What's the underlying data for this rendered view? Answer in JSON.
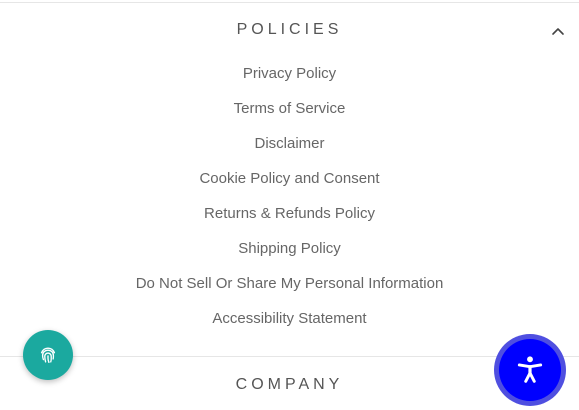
{
  "policies": {
    "title": "POLICIES",
    "links": [
      {
        "label": "Privacy Policy"
      },
      {
        "label": "Terms of Service"
      },
      {
        "label": "Disclaimer"
      },
      {
        "label": "Cookie Policy and Consent"
      },
      {
        "label": "Returns & Refunds Policy"
      },
      {
        "label": "Shipping Policy"
      },
      {
        "label": "Do Not Sell Or Share My Personal Information"
      },
      {
        "label": "Accessibility Statement"
      }
    ]
  },
  "company": {
    "title": "COMPANY"
  },
  "icons": {
    "policies_toggle": "chevron-up-icon",
    "privacy_widget": "fingerprint-icon",
    "accessibility_widget": "accessibility-person-icon"
  },
  "colors": {
    "privacy_widget_bg": "#1ba99f",
    "accessibility_widget_bg": "#0000ff",
    "text": "#666666"
  }
}
